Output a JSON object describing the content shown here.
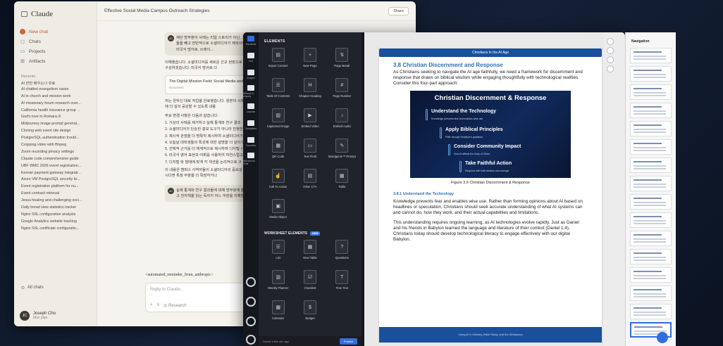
{
  "claude": {
    "brand": "Claude",
    "conversation_title": "Effective Social Media Campus Outreach Strategies",
    "share_label": "Share",
    "nav": [
      {
        "label": "New chat"
      },
      {
        "label": "Chats"
      },
      {
        "label": "Projects"
      },
      {
        "label": "Artifacts"
      }
    ],
    "recents_title": "Recents",
    "recents": [
      "AI 한번 배우는나 유료",
      "AI chatbot evangelism cases",
      "AI in church and mission work",
      "AI missionary forum research over...",
      "California health insurance group ...",
      "God's love in Romans 8",
      "Midjourney image prompt generat...",
      "Cloning web event site design",
      "PostgreSQL authentication troubl...",
      "Cropping video with ffmpeg",
      "Zoom recording privacy settings",
      "Claude code comprehensive guide",
      "UBF WMC 2026 event registration...",
      "Korean payment gateway integrati...",
      "Azure VM PostgreSQL security br...",
      "Event registration platform for nu...",
      "Event contract retrieval",
      "Jesus healing and challenging soci...",
      "Daily bread view statistics tracker",
      "Nginx SSL configuration analysis",
      "Google Analytics website tracking",
      "Nginx SSL certificate configuratio..."
    ],
    "all_chats": "All chats",
    "user_name": "Joseph Cho",
    "user_plan": "Max plan",
    "user_initials": "JC",
    "message1": "재단 방부분이 사례는 리얼 스토리가 아닌, 그 사례로 드 것들을 빼고 전반적으로 소셜미디어가 제외이에서, 미인스런 미국식 방어로, 쓰레이...",
    "reply1": "이해했습니다. 소셜미디어를 새로운 선교 현장으로 있는 내용으로 재구성하겠습니다. 미국식 방어로 다",
    "doc_title": "The Digital Mission Field: Social Media and Ca",
    "doc_type": "Document",
    "reply2": "저는 완하신 대로 작업을 완료했습니다. 원본의 시례 fluid이라는 주제에 더 깊이 공감할 수 있도록 내용",
    "changes_title": "주요 변경 사항은 다음과 같습니다:",
    "changes": [
      "1. 가상의 사례를 제거하고 실제 통계와 연구 결과",
      "2. 소셜미디어가 단순한 홍보 도구가 아니라 진정한",
      "3. 제시적 관점을 더 명확히 제시하여 소셜미디어가 강조했습니다.",
      "4. 오늘날 대학생들의 특성에 대한 설명을 더 깊이 다",
      "5. 선택적 근거를 더 체계적으로 제시하며 디지털 시",
      "6. 미국식 영어 표현과 어휘를 사용하여 자연스럽고",
      "7. 디지털 학 형태에 맞게 각 섹션을 논리적으로 구"
    ],
    "reply3": "이 내용은 캠퍼스 사역자들이 소셜미디어의 중요성 것입니다. 필요하시다면 특정 부분을 더 확장하거나",
    "message2": "실제 통계와 연구 결과들에 대해 방부분에 출처 하라. 그리고 전자책을 읽는 독자가 어느 부분을 이해할 할 필이다.",
    "reminder": "<automated_reminder_from_anthropic>",
    "reply_placeholder": "Reply to Claude...",
    "research_label": "Research"
  },
  "editor": {
    "rail": [
      {
        "label": "Elements"
      },
      {
        "label": "Text"
      },
      {
        "label": "Images"
      },
      {
        "label": "Artwork & shapes"
      },
      {
        "label": "Layouts"
      },
      {
        "label": "Templates"
      },
      {
        "label": "Favorites"
      },
      {
        "label": "Wordpress Chat"
      }
    ],
    "elements_title": "ELEMENTS",
    "elements": [
      {
        "label": "Import Content",
        "glyph": "▤"
      },
      {
        "label": "New Page",
        "glyph": "+"
      },
      {
        "label": "Page Break",
        "glyph": "⇅"
      },
      {
        "label": "Table Of Contents",
        "glyph": "☰"
      },
      {
        "label": "Chapter Heading",
        "glyph": "H"
      },
      {
        "label": "Page Number",
        "glyph": "#"
      },
      {
        "label": "Captioned Image",
        "glyph": "▨"
      },
      {
        "label": "Embed Video",
        "glyph": "▶"
      },
      {
        "label": "Embed Audio",
        "glyph": "♪"
      },
      {
        "label": "QR Code",
        "glyph": "▦"
      },
      {
        "label": "Text Field",
        "glyph": "▭"
      },
      {
        "label": "Wordgenie™ Prompt",
        "glyph": "✎"
      },
      {
        "label": "Call To Action",
        "glyph": "☝"
      },
      {
        "label": "Inline CTA",
        "glyph": "▤"
      },
      {
        "label": "Table",
        "glyph": "▦"
      },
      {
        "label": "Media Object",
        "glyph": "▣"
      }
    ],
    "worksheet_title": "WORKSHEET ELEMENTS",
    "worksheet_badge": "NEW",
    "worksheet": [
      {
        "label": "List",
        "glyph": "☰"
      },
      {
        "label": "New Table",
        "glyph": "▦"
      },
      {
        "label": "Questions",
        "glyph": "?"
      },
      {
        "label": "Weekly Planner",
        "glyph": "▥"
      },
      {
        "label": "Checklist",
        "glyph": "☑"
      },
      {
        "label": "Free Text",
        "glyph": "T"
      },
      {
        "label": "Calendar",
        "glyph": "▦"
      },
      {
        "label": "Budget",
        "glyph": "$"
      }
    ],
    "footer_text": "Saved a few sec ago",
    "publish_label": "Publish",
    "page": {
      "header": "Christians In the AI Age",
      "section_title": "3.8 Christian Discernment and Response",
      "intro": "As Christians seeking to navigate the AI age faithfully, we need a framework for discernment and response that draws on biblical wisdom while engaging thoughtfully with technological realities. Consider this four-part approach:",
      "figure_title": "Christian Discernment & Response",
      "steps": [
        {
          "title": "Understand the Technology",
          "sub": "Knowledge prevents fear and enables wise use"
        },
        {
          "title": "Apply Biblical Principles",
          "sub": "Filter through Scripture's guidance"
        },
        {
          "title": "Consider Community Impact",
          "sub": "How AI affects the body of Christ"
        },
        {
          "title": "Take Faithful Action",
          "sub": "Respond with both wisdom and courage"
        }
      ],
      "figure_caption": "Figure 3.6 Christian Discernment & Response",
      "subsection_title": "3.8.1 Understand the Technology",
      "para1": "Knowledge prevents fear and enables wise use. Rather than forming opinions about AI based on headlines or speculation, Christians should seek accurate understanding of what AI systems can and cannot do, how they work, and their actual capabilities and limitations.",
      "para2": "This understanding requires ongoing learning, as AI technologies evolve rapidly. Just as Daniel and his friends in Babylon learned the language and literature of their context (Daniel 1:4), Christians today should develop technological literacy to engage effectively with our digital Babylon.",
      "footer": "Using AI in Ministry, Bible Study, and the Workplace"
    },
    "navigation_title": "Navigation"
  },
  "colors": {
    "accent": "#2f6fe0",
    "brand_blue": "#1a4f9c",
    "claude_orange": "#d4643a"
  }
}
